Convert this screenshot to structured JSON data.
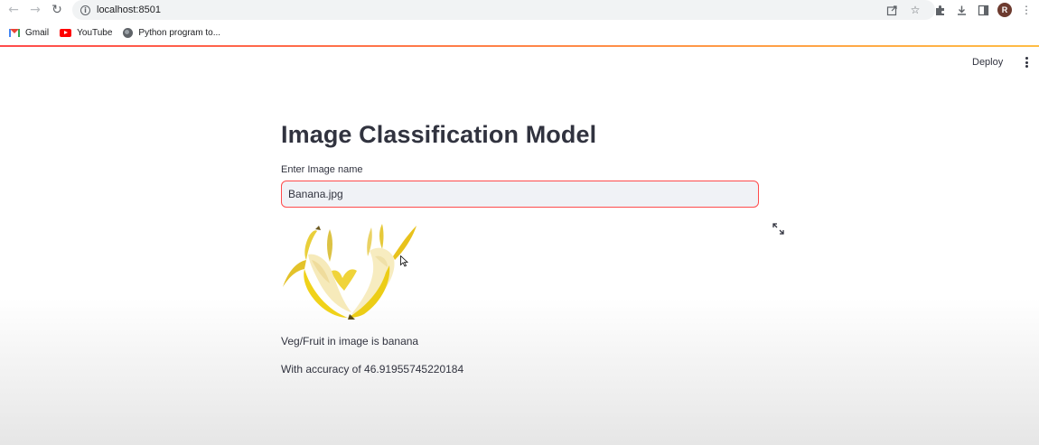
{
  "browser": {
    "url": "localhost:8501",
    "bookmarks": [
      {
        "label": "Gmail",
        "icon": "gmail-icon"
      },
      {
        "label": "YouTube",
        "icon": "youtube-icon"
      },
      {
        "label": "Python program to...",
        "icon": "globe-icon"
      }
    ],
    "profile_initial": "R"
  },
  "header": {
    "deploy_label": "Deploy"
  },
  "main": {
    "title": "Image Classification Model",
    "input_label": "Enter Image name",
    "input_value": "Banana.jpg",
    "result": "Veg/Fruit in image is banana",
    "accuracy": "With accuracy of 46.91955745220184"
  },
  "colors": {
    "accent": "#ff4b4b",
    "accent_secondary": "#ffbd45",
    "text": "#31333f",
    "input_bg": "#f0f2f6"
  }
}
